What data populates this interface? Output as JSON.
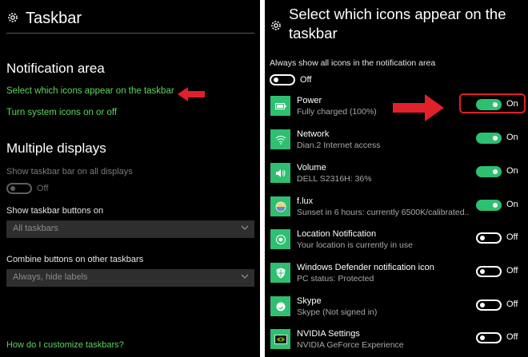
{
  "left": {
    "title": "Taskbar",
    "notif_heading": "Notification area",
    "link_select_icons": "Select which icons appear on the taskbar",
    "link_system_icons": "Turn system icons on or off",
    "multi_heading": "Multiple displays",
    "show_all_label": "Show taskbar bar on all displays",
    "show_all_state": "Off",
    "buttons_on_label": "Show taskbar buttons on",
    "buttons_on_value": "All taskbars",
    "combine_label": "Combine buttons on other taskbars",
    "combine_value": "Always, hide labels",
    "help_link": "How do I customize taskbars?"
  },
  "right": {
    "title": "Select which icons appear on the taskbar",
    "always_show_label": "Always show all icons in the notification area",
    "always_show_state": "Off",
    "items": [
      {
        "name": "Power",
        "sub": "Fully charged (100%)",
        "state": "On",
        "icon": "battery-icon"
      },
      {
        "name": "Network",
        "sub": "Dian.2 Internet access",
        "state": "On",
        "icon": "wifi-icon"
      },
      {
        "name": "Volume",
        "sub": "DELL S2316H: 36%",
        "state": "On",
        "icon": "speaker-icon"
      },
      {
        "name": "f.lux",
        "sub": "Sunset in 6 hours: currently 6500K/calibrated...",
        "state": "On",
        "icon": "flux-icon"
      },
      {
        "name": "Location Notification",
        "sub": "Your location is currently in use",
        "state": "Off",
        "icon": "location-icon"
      },
      {
        "name": "Windows Defender notification icon",
        "sub": "PC status: Protected",
        "state": "Off",
        "icon": "shield-icon"
      },
      {
        "name": "Skype",
        "sub": "Skype (Not signed in)",
        "state": "Off",
        "icon": "skype-icon"
      },
      {
        "name": "NVIDIA Settings",
        "sub": "NVIDIA GeForce Experience",
        "state": "Off",
        "icon": "nvidia-icon"
      }
    ]
  },
  "colors": {
    "accent": "#2fbf71",
    "link": "#5cd65c",
    "annotation": "#e0202a"
  }
}
